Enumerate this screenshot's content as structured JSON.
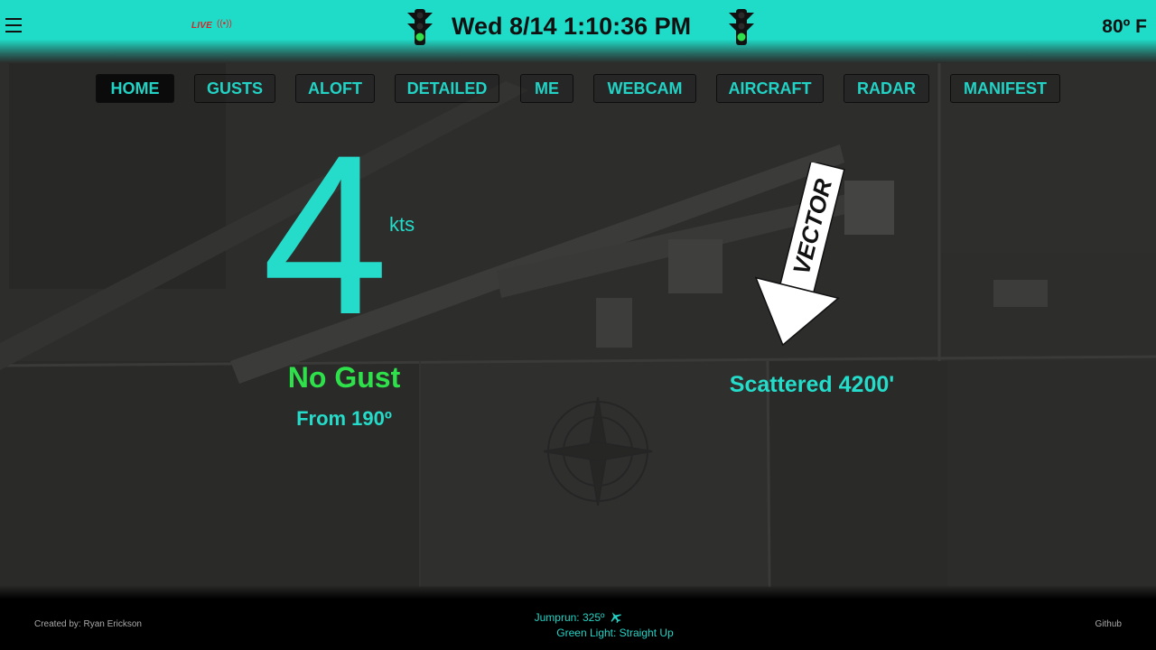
{
  "header": {
    "live_label": "LIVE",
    "clock": "Wed 8/14 1:10:36 PM",
    "temperature": "80º F"
  },
  "nav": {
    "items": [
      "HOME",
      "GUSTS",
      "ALOFT",
      "DETAILED",
      "ME",
      "WEBCAM",
      "AIRCRAFT",
      "RADAR",
      "MANIFEST"
    ],
    "active": "HOME"
  },
  "wind": {
    "speed": "4",
    "unit": "kts",
    "gust": "No Gust",
    "direction": "From 190º"
  },
  "clouds": {
    "text": "Scattered 4200'",
    "arrow_logo_text": "VECTOR"
  },
  "footer": {
    "created_by": "Created by: Ryan Erickson",
    "jumprun": "Jumprun: 325º",
    "green_light": "Green Light: Straight Up",
    "github": "Github"
  },
  "colors": {
    "accent": "#22d3c5",
    "header_bg": "#1fdcc8",
    "gust_green": "#2ee04a",
    "live_red": "#d6262a"
  }
}
